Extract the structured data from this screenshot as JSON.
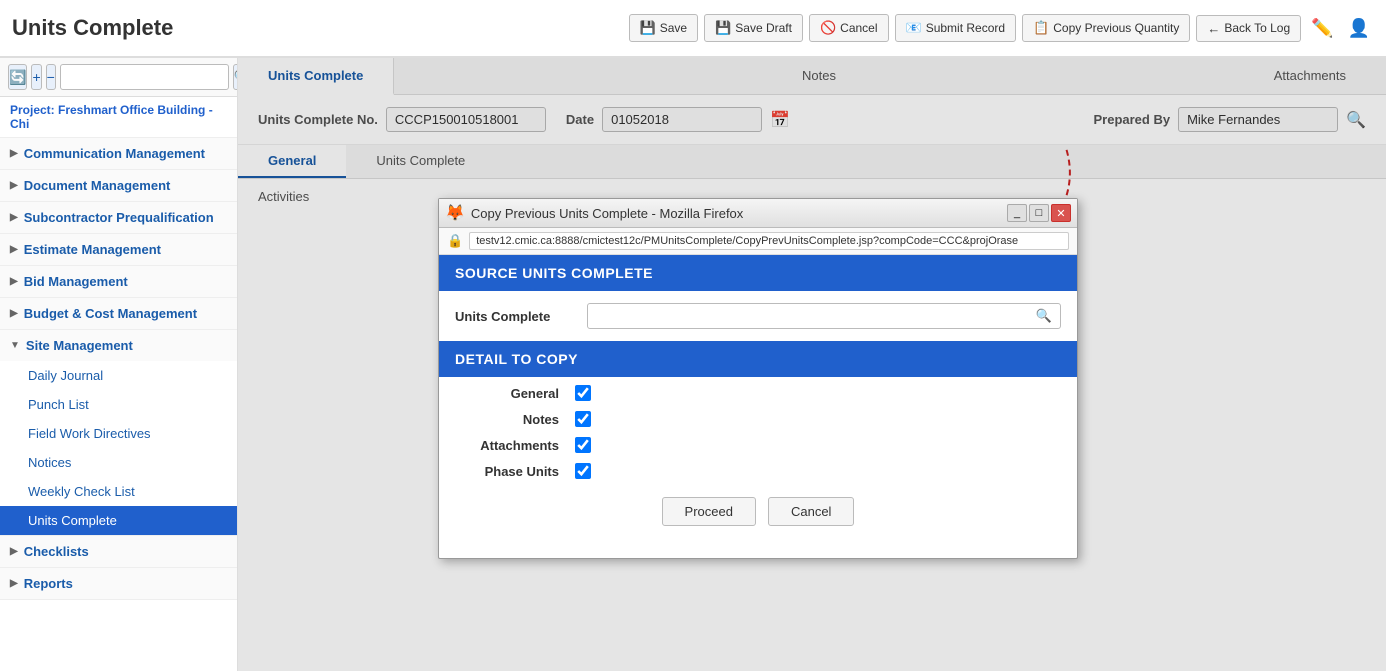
{
  "app": {
    "title": "Units Complete"
  },
  "header": {
    "buttons": [
      {
        "id": "save",
        "icon": "💾",
        "label": "Save"
      },
      {
        "id": "save-draft",
        "icon": "💾",
        "label": "Save Draft"
      },
      {
        "id": "cancel",
        "icon": "🚫",
        "label": "Cancel"
      },
      {
        "id": "submit-record",
        "icon": "📧",
        "label": "Submit Record"
      },
      {
        "id": "copy-prev-qty",
        "icon": "📋",
        "label": "Copy Previous Quantity"
      },
      {
        "id": "back-to-log",
        "icon": "←",
        "label": "Back To Log"
      }
    ]
  },
  "sidebar": {
    "project_label": "Project: Freshmart Office Building - Chi",
    "nav_sections": [
      {
        "id": "communication-management",
        "label": "Communication Management",
        "expanded": false,
        "items": []
      },
      {
        "id": "document-management",
        "label": "Document Management",
        "expanded": false,
        "items": []
      },
      {
        "id": "subcontractor-prequalification",
        "label": "Subcontractor Prequalification",
        "expanded": false,
        "items": []
      },
      {
        "id": "estimate-management",
        "label": "Estimate Management",
        "expanded": false,
        "items": []
      },
      {
        "id": "bid-management",
        "label": "Bid Management",
        "expanded": false,
        "items": []
      },
      {
        "id": "budget-cost-management",
        "label": "Budget & Cost Management",
        "expanded": false,
        "items": []
      },
      {
        "id": "site-management",
        "label": "Site Management",
        "expanded": true,
        "items": [
          {
            "id": "daily-journal",
            "label": "Daily Journal",
            "active": false
          },
          {
            "id": "punch-list",
            "label": "Punch List",
            "active": false
          },
          {
            "id": "field-work-directives",
            "label": "Field Work Directives",
            "active": false
          },
          {
            "id": "notices",
            "label": "Notices",
            "active": false
          },
          {
            "id": "weekly-check-list",
            "label": "Weekly Check List",
            "active": false
          },
          {
            "id": "units-complete",
            "label": "Units Complete",
            "active": true
          }
        ]
      },
      {
        "id": "checklists",
        "label": "Checklists",
        "expanded": false,
        "items": []
      },
      {
        "id": "reports",
        "label": "Reports",
        "expanded": false,
        "items": []
      }
    ]
  },
  "main_tabs": [
    {
      "id": "units-complete",
      "label": "Units Complete",
      "active": true
    },
    {
      "id": "notes",
      "label": "Notes",
      "active": false
    },
    {
      "id": "attachments",
      "label": "Attachments",
      "active": false
    }
  ],
  "form": {
    "units_complete_no_label": "Units Complete No.",
    "units_complete_no_value": "CCCP150010518001",
    "date_label": "Date",
    "date_value": "01052018",
    "prepared_by_label": "Prepared By",
    "prepared_by_value": "Mike Fernandes"
  },
  "sub_tabs": [
    {
      "id": "general",
      "label": "General",
      "active": true
    },
    {
      "id": "units-complete-sub",
      "label": "Units Complete",
      "active": false
    }
  ],
  "activities_label": "Activities",
  "modal": {
    "title": "Copy Previous Units Complete - Mozilla Firefox",
    "url": "testv12.cmic.ca:8888/cmictest12c/PMUnitsComplete/CopyPrevUnitsComplete.jsp?compCode=CCC&projOrase",
    "source_header": "SOURCE UNITS COMPLETE",
    "units_complete_label": "Units Complete",
    "detail_header": "DETAIL TO COPY",
    "checkboxes": [
      {
        "id": "general",
        "label": "General",
        "checked": true
      },
      {
        "id": "notes",
        "label": "Notes",
        "checked": true
      },
      {
        "id": "attachments",
        "label": "Attachments",
        "checked": true
      },
      {
        "id": "phase-units",
        "label": "Phase Units",
        "checked": true
      }
    ],
    "proceed_label": "Proceed",
    "cancel_label": "Cancel"
  }
}
